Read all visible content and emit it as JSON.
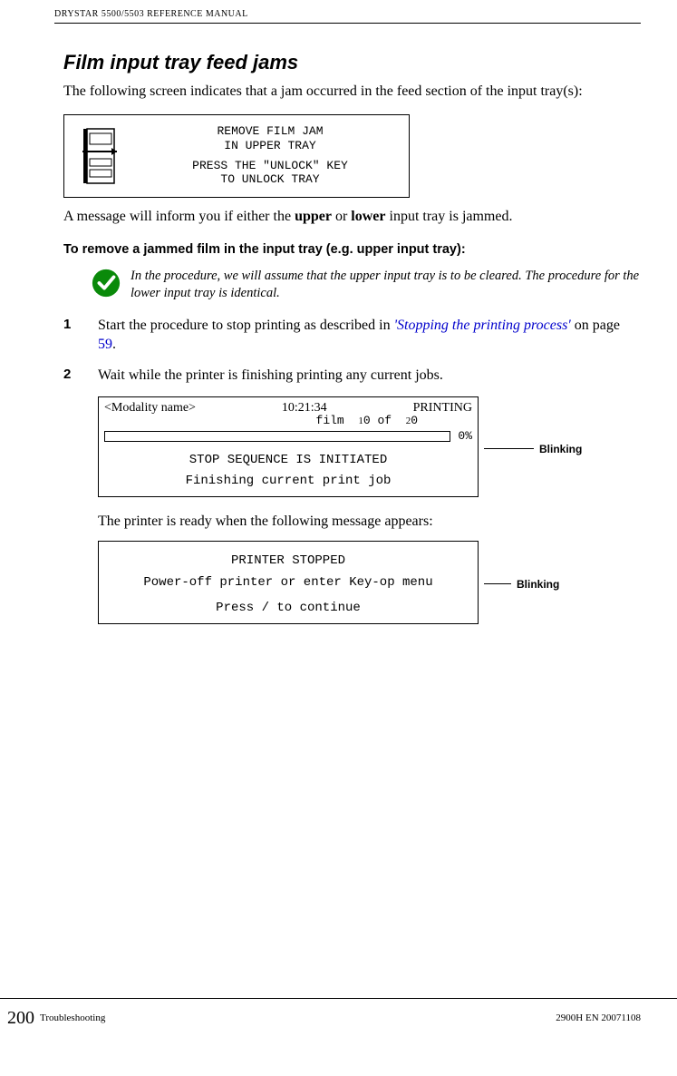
{
  "header": {
    "running": "DRYSTAR 5500/5503 REFERENCE MANUAL"
  },
  "section": {
    "title": "Film input tray feed jams",
    "intro": "The following screen indicates that a jam occurred in the feed section of the input tray(s):"
  },
  "panel1": {
    "line1": "REMOVE FILM JAM",
    "line2": "IN UPPER TRAY",
    "line3": "PRESS THE \"UNLOCK\" KEY",
    "line4": "TO UNLOCK TRAY"
  },
  "after_panel1_pre": "A message will inform you if either the ",
  "after_panel1_bold1": "upper",
  "after_panel1_mid": " or ",
  "after_panel1_bold2": "lower",
  "after_panel1_post": " input tray is jammed.",
  "subheading": "To remove a jammed film in the input tray (e.g. upper input tray):",
  "note": "In the procedure, we will assume that the upper input tray is to be cleared. The procedure for the lower input tray is identical.",
  "steps": {
    "s1": {
      "num": "1",
      "pre": "Start the procedure to stop printing as described in ",
      "link": "'Stopping the printing process'",
      "mid": " on page ",
      "page": "59",
      "post": "."
    },
    "s2": {
      "num": "2",
      "text": "Wait while the printer is finishing printing any current jobs."
    }
  },
  "panel2": {
    "top_left": "<Modality name>",
    "top_mid": "10:21:34",
    "top_right": "PRINTING",
    "film_word": "film",
    "film_d1": "1",
    "film_zero1": "0",
    "film_of": "of",
    "film_d2": "2",
    "film_zero2": "0",
    "pct": "0%",
    "line1": "STOP SEQUENCE IS INITIATED",
    "line2": "Finishing current print job"
  },
  "blinking_label": "Blinking",
  "after_panel2": "The printer is ready when the following message appears:",
  "panel3": {
    "line1": "PRINTER STOPPED",
    "line2": "Power-off printer or enter Key-op menu",
    "line3": "Press / to continue"
  },
  "footer": {
    "page": "200",
    "left": "Troubleshooting",
    "right": "2900H EN 20071108"
  }
}
